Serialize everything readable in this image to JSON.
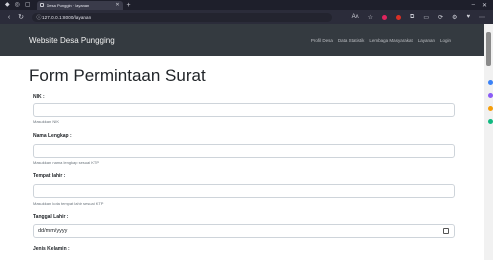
{
  "browser": {
    "tab_title": "Desa Punggin · layanan",
    "url": "127.0.0.1:8000/layanan",
    "new_tab": "+"
  },
  "site": {
    "brand": "Website Desa Pungging",
    "menu": [
      "Profil Desa",
      "Data Statistik",
      "Lembaga Masyarakat",
      "Layanan",
      "Login"
    ]
  },
  "form": {
    "title": "Form Permintaan Surat",
    "fields": [
      {
        "label": "NIK :",
        "help": "Masukkan NIK"
      },
      {
        "label": "Nama Lengkap :",
        "help": "Masukkan nama lengkap sesuai KTP"
      },
      {
        "label": "Tempat lahir :",
        "help": "Masukkan kota tempat lahir sesuai KTP"
      },
      {
        "label": "Tanggal Lahir :",
        "value": "dd/mm/yyyy"
      },
      {
        "label": "Jenis Kelamin :"
      }
    ]
  }
}
